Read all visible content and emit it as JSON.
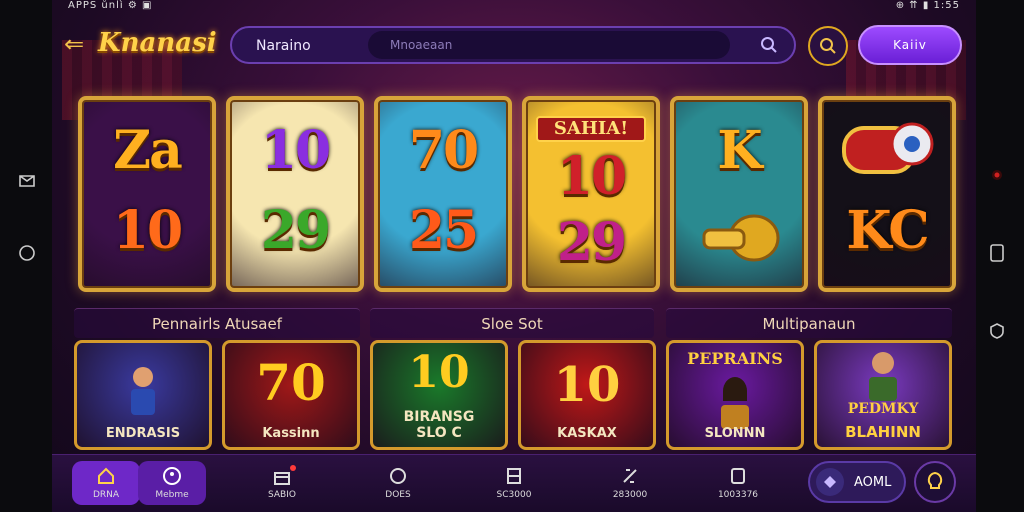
{
  "status": {
    "left": "APPS ŭnlì ⚙ ▣",
    "right": "⊕ ⇈ ▮ 1:55"
  },
  "topbar": {
    "brand": "Knanasi",
    "search_label": "Naraino",
    "search_placeholder": "Mnoaeaan",
    "button_label": "Kaiiv"
  },
  "tiles": [
    {
      "line1": "Za",
      "line2": "10",
      "bg": "#3a1048",
      "c1": "#ffb020",
      "c2": "#ff6a1a"
    },
    {
      "line1": "10",
      "line2": "29",
      "bg": "#f6e6b0",
      "c1": "#8a2ee0",
      "c2": "#3aa82a"
    },
    {
      "line1": "70",
      "line2": "25",
      "bg": "#3aa8d0",
      "c1": "#ff8a1a",
      "c2": "#ff5a1a"
    },
    {
      "line1": "10",
      "line2": "29",
      "bg": "#f4c030",
      "c1": "#d0202a",
      "c2": "#c0208a",
      "banner": "SAHIA!"
    },
    {
      "line1": "K",
      "line2": "",
      "bg": "#2a8a90",
      "c1": "#ffb020",
      "c2": "#ffb020"
    },
    {
      "line1": "",
      "line2": "KC",
      "bg": "#141018",
      "c1": "#ff8a1a",
      "c2": "#ff8a1a"
    }
  ],
  "categories": [
    "Pennairls Atusaef",
    "Sloe Sot",
    "Multipanaun"
  ],
  "games": [
    {
      "top": "",
      "bottom": "ENDRASIS",
      "bg": "#3a3aa0"
    },
    {
      "top": "70",
      "bottom": "Kassinn",
      "bg": "#a01818"
    },
    {
      "top": "10",
      "bottom": "BIRANSG SLO C",
      "bg": "#1a7a2a"
    },
    {
      "top": "10",
      "bottom": "KASKAX",
      "bg": "#c01818"
    },
    {
      "top": "PEPRAINS",
      "bottom": "SLONNN",
      "bg": "#6a1aa0"
    },
    {
      "top": "PEDMKY",
      "bottom": "BLAHINN",
      "bg": "#7a3ac0"
    }
  ],
  "nav": [
    {
      "label": "DRNA",
      "icon": "home-icon"
    },
    {
      "label": "Mebme",
      "icon": "profile-icon"
    },
    {
      "label": "SABIO",
      "icon": "gift-icon"
    },
    {
      "label": "DOES",
      "icon": "game-icon"
    },
    {
      "label": "SC3000",
      "icon": "grid-icon"
    },
    {
      "label": "283000",
      "icon": "chip-icon"
    },
    {
      "label": "1003376",
      "icon": "trophy-icon"
    }
  ],
  "nav_pill": "AOML",
  "colors": {
    "gold": "#d8a53a",
    "purple": "#6e28c8",
    "bg": "#1d0a24"
  }
}
